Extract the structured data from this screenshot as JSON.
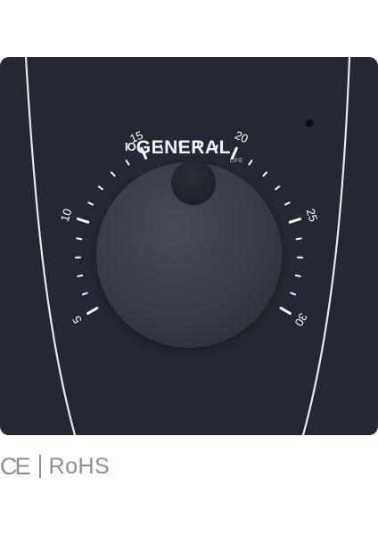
{
  "device": {
    "brand": {
      "prefix": "IO",
      "name": "GENERAL",
      "sub": "LIFE"
    },
    "dial": {
      "scale_labels": [
        "5",
        "10",
        "15",
        "20",
        "25",
        "30"
      ],
      "scale_min": 5,
      "scale_max": 30
    },
    "colors": {
      "body": "#242832",
      "knob": "#3a3e48",
      "markings": "#ffffff",
      "trim_line": "#e8e8e8"
    }
  },
  "certifications": {
    "ce": "CE",
    "rohs": "RoHS"
  }
}
